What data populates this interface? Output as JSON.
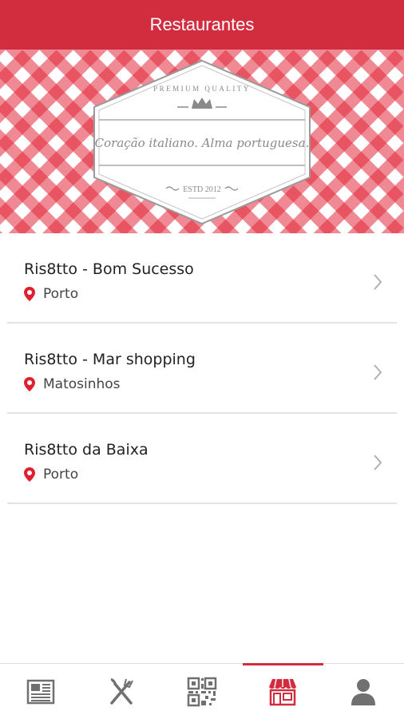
{
  "header": {
    "title": "Restaurantes"
  },
  "banner": {
    "top_text": "PREMIUM QUALITY",
    "tagline": "Coração italiano. Alma portuguesa.",
    "estd": "ESTD 2012"
  },
  "restaurants": [
    {
      "name": "Ris8tto - Bom Sucesso",
      "city": "Porto"
    },
    {
      "name": "Ris8tto - Mar shopping",
      "city": "Matosinhos"
    },
    {
      "name": "Ris8tto da Baixa",
      "city": "Porto"
    }
  ],
  "bottom_nav": {
    "items": [
      {
        "icon": "newspaper-icon"
      },
      {
        "icon": "fork-knife-icon"
      },
      {
        "icon": "qr-code-icon"
      },
      {
        "icon": "store-icon",
        "active": true
      },
      {
        "icon": "user-icon"
      }
    ]
  },
  "colors": {
    "brand": "#d22d3f",
    "pin": "#e0202f",
    "chevron": "#b0b0b0"
  }
}
